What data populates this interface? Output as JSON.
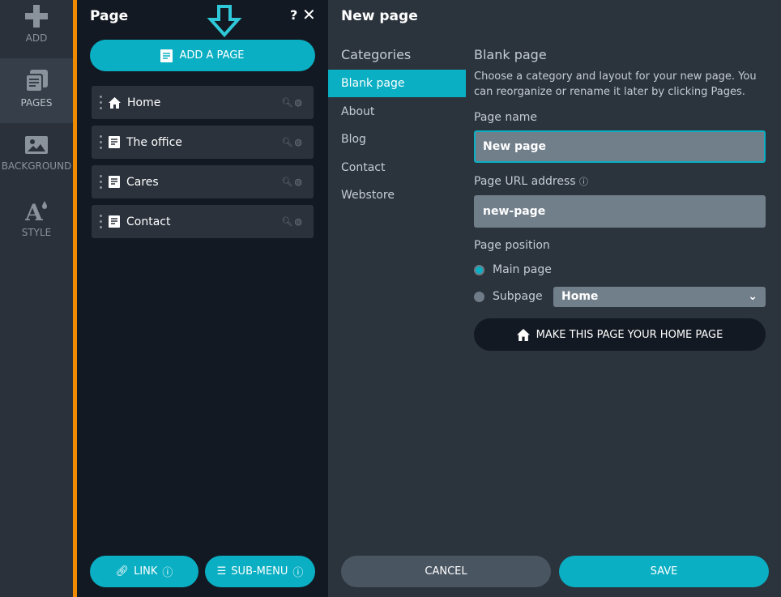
{
  "rail": [
    {
      "label": "ADD",
      "icon": "plus-icon"
    },
    {
      "label": "PAGES",
      "icon": "pages-icon",
      "active": true
    },
    {
      "label": "BACKGROUND",
      "icon": "image-icon"
    },
    {
      "label": "STYLE",
      "icon": "style-icon"
    }
  ],
  "panel": {
    "title": "Page",
    "help": "?",
    "close": "✕",
    "add_label": "ADD A PAGE",
    "pages": [
      {
        "label": "Home",
        "icon": "home-icon"
      },
      {
        "label": "The office",
        "icon": "page-icon"
      },
      {
        "label": "Cares",
        "icon": "page-icon"
      },
      {
        "label": "Contact",
        "icon": "page-icon"
      }
    ],
    "link_label": "LINK",
    "submenu_label": "SUB-MENU"
  },
  "main": {
    "title": "New page",
    "categories_heading": "Categories",
    "categories": [
      "Blank page",
      "About",
      "Blog",
      "Contact",
      "Webstore"
    ],
    "form": {
      "heading": "Blank page",
      "description": "Choose a category and layout for your new page. You can reorganize or rename it later by clicking Pages.",
      "name_label": "Page name",
      "name_value": "New page",
      "url_label": "Page URL address",
      "url_value": "new-page",
      "position_label": "Page position",
      "main_page": "Main page",
      "subpage": "Subpage",
      "subpage_parent": "Home",
      "selected_position": "Main page",
      "home_button": "MAKE THIS PAGE YOUR HOME PAGE"
    },
    "cancel": "CANCEL",
    "save": "SAVE"
  },
  "colors": {
    "accent": "#0aafc3",
    "orange": "#f08a00"
  }
}
